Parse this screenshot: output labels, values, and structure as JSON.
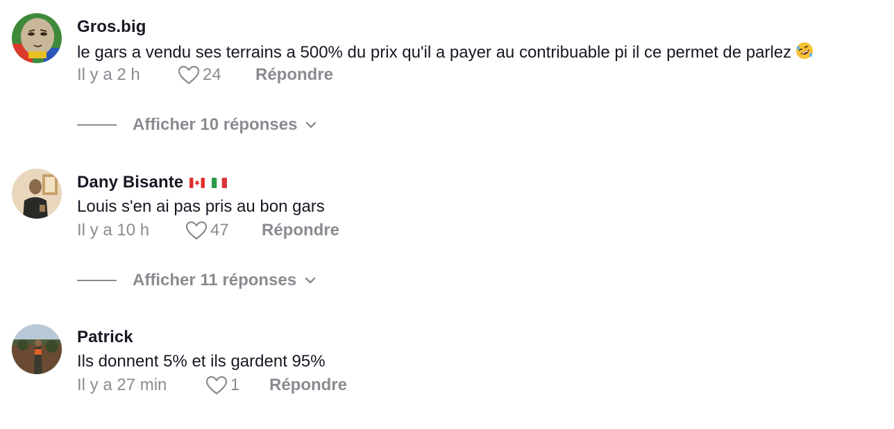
{
  "comments": [
    {
      "username": "Gros.big",
      "text": "le gars a vendu ses terrains a 500% du prix qu'il a payer au contribuable pi il ce permet de parlez",
      "emoji": "rolling-on-floor-laughing-emoji",
      "time": "Il y a 2 h",
      "likes": "24",
      "reply_label": "Répondre",
      "view_replies": "Afficher 10 réponses"
    },
    {
      "username": "Dany Bisante",
      "flags": [
        "canada-flag-icon",
        "italy-flag-icon"
      ],
      "text": "Louis s'en ai pas pris au bon gars",
      "time": "Il y a 10 h",
      "likes": "47",
      "reply_label": "Répondre",
      "view_replies": "Afficher 11 réponses"
    },
    {
      "username": "Patrick",
      "text": "Ils donnent 5% et ils gardent 95%",
      "time": "Il y a 27 min",
      "likes": "1",
      "reply_label": "Répondre"
    }
  ],
  "colors": {
    "text_primary": "#161823",
    "text_secondary": "#8a8b91"
  }
}
